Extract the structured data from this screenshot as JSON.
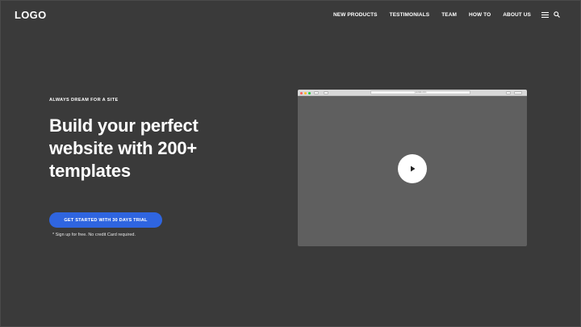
{
  "header": {
    "logo": "LOGO",
    "nav": [
      "NEW PRODUCTS",
      "TESTIMONIALS",
      "TEAM",
      "HOW TO",
      "ABOUT US"
    ],
    "icons": [
      "menu-icon",
      "search-icon"
    ]
  },
  "hero": {
    "eyebrow": "ALWAYS DREAM FOR A SITE",
    "headline_lines": [
      "Build your perfect",
      "website with 200+",
      "templates"
    ],
    "cta_label": "GET STARTED WITH 30 DAYS TRIAL",
    "note": "* Sign up for free. No credit Card required."
  },
  "video": {
    "url_text": "yoursite.com",
    "play_icon": "play-icon"
  },
  "colors": {
    "background": "#3a3a3a",
    "cta": "#2f65e0",
    "video_frame": "#5f5f5f"
  }
}
